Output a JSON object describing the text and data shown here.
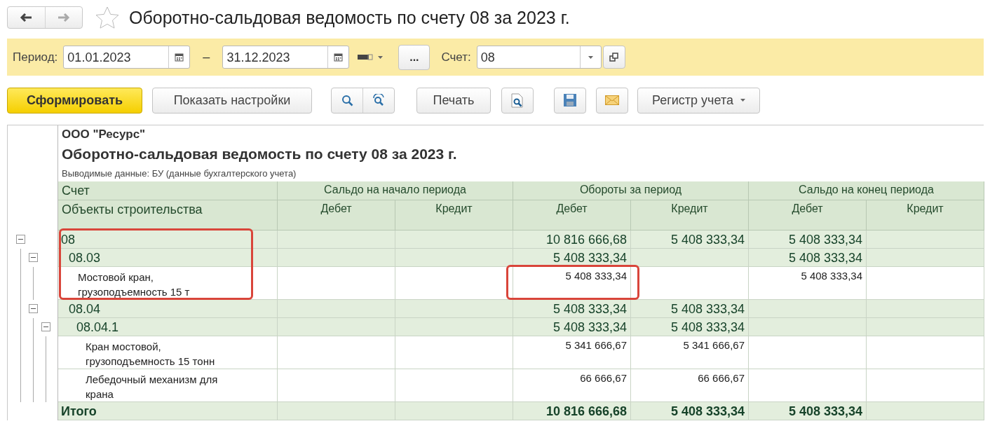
{
  "window": {
    "title": "Оборотно-сальдовая ведомость по счету 08 за 2023 г."
  },
  "nav": [
    {
      "kind": "back",
      "disabled": false
    },
    {
      "kind": "forward",
      "disabled": true
    }
  ],
  "favorite": false,
  "filters": {
    "period_label": "Период:",
    "date_from": "01.01.2023",
    "separator": "–",
    "date_to": "31.12.2023",
    "more_button": "...",
    "account_label": "Счет:",
    "account": "08"
  },
  "toolbar": {
    "generate": "Сформировать",
    "settings": "Показать настройки",
    "print": "Печать",
    "register": "Регистр учета"
  },
  "report": {
    "organization": "ООО \"Ресурс\"",
    "title": "Оборотно-сальдовая ведомость по счету 08 за 2023 г.",
    "subtitle": "Выводимые данные: БУ (данные бухгалтерского учета)",
    "columns": {
      "account": "Счет",
      "objects": "Объекты строительства",
      "groups": [
        {
          "label": "Сальдо на начало периода",
          "sub": [
            "Дебет",
            "Кредит"
          ]
        },
        {
          "label": "Обороты за период",
          "sub": [
            "Дебет",
            "Кредит"
          ]
        },
        {
          "label": "Сальдо на конец периода",
          "sub": [
            "Дебет",
            "Кредит"
          ]
        }
      ]
    },
    "rows": [
      {
        "kind": "group",
        "label": "08",
        "expanded": true,
        "values": {
          "turnover_debit": "10 816 666,68",
          "turnover_credit": "5 408 333,34",
          "closing_debit": "5 408 333,34"
        },
        "children": [
          {
            "kind": "group",
            "label": "08.03",
            "expanded": true,
            "values": {
              "turnover_debit": "5 408 333,34",
              "closing_debit": "5 408 333,34"
            },
            "children": [
              {
                "kind": "item",
                "label": "Мостовой кран, грузоподъемность 15 т",
                "values": {
                  "turnover_debit": "5 408 333,34",
                  "closing_debit": "5 408 333,34"
                }
              }
            ]
          },
          {
            "kind": "group",
            "label": "08.04",
            "expanded": true,
            "values": {
              "turnover_debit": "5 408 333,34",
              "turnover_credit": "5 408 333,34"
            },
            "children": [
              {
                "kind": "group",
                "label": "08.04.1",
                "expanded": true,
                "values": {
                  "turnover_debit": "5 408 333,34",
                  "turnover_credit": "5 408 333,34"
                },
                "children": [
                  {
                    "kind": "item",
                    "label": "Кран мостовой, грузоподъемность 15 тонн",
                    "values": {
                      "turnover_debit": "5 341 666,67",
                      "turnover_credit": "5 341 666,67"
                    }
                  },
                  {
                    "kind": "item",
                    "label": "Лебедочный механизм для крана",
                    "values": {
                      "turnover_debit": "66 666,67",
                      "turnover_credit": "66 666,67"
                    }
                  }
                ]
              }
            ]
          }
        ]
      }
    ],
    "total": {
      "label": "Итого",
      "values": {
        "turnover_debit": "10 816 666,68",
        "turnover_credit": "5 408 333,34",
        "closing_debit": "5 408 333,34"
      }
    }
  }
}
